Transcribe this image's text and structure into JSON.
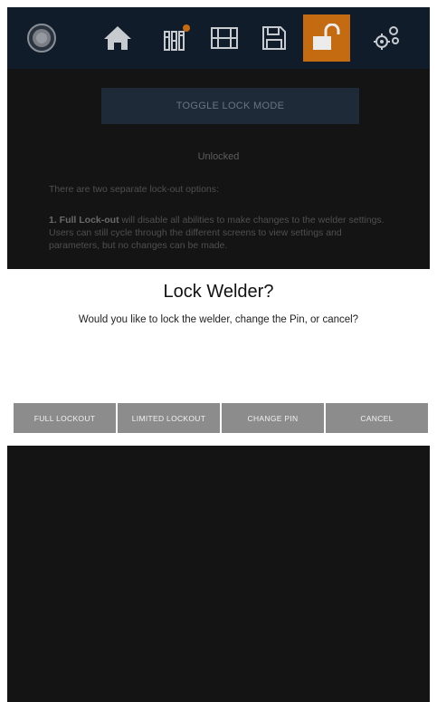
{
  "nav": {
    "items": [
      {
        "icon": "power-icon",
        "active": false
      },
      {
        "icon": "home-icon",
        "active": false
      },
      {
        "icon": "parameters-icon",
        "active": false
      },
      {
        "icon": "memory-icon",
        "active": false
      },
      {
        "icon": "save-icon",
        "active": false
      },
      {
        "icon": "lock-icon",
        "active": true
      },
      {
        "icon": "settings-icon",
        "active": false
      }
    ],
    "accent_color": "#c46a10",
    "bar_color": "#111c2b"
  },
  "main": {
    "toggle_label": "TOGGLE LOCK MODE",
    "status": "Unlocked",
    "intro": "There are two separate lock-out options:",
    "option1_title": "1. Full Lock-out",
    "option1_text": " will disable all abilities to make changes to the welder settings. Users can still cycle through the different screens to view settings and parameters, but no changes can be made."
  },
  "dialog": {
    "title": "Lock Welder?",
    "message": "Would you like to lock the welder, change the Pin, or cancel?",
    "buttons": {
      "full_lockout": "FULL LOCKOUT",
      "limited_lockout": "LIMITED LOCKOUT",
      "change_pin": "CHANGE PIN",
      "cancel": "CANCEL"
    }
  }
}
